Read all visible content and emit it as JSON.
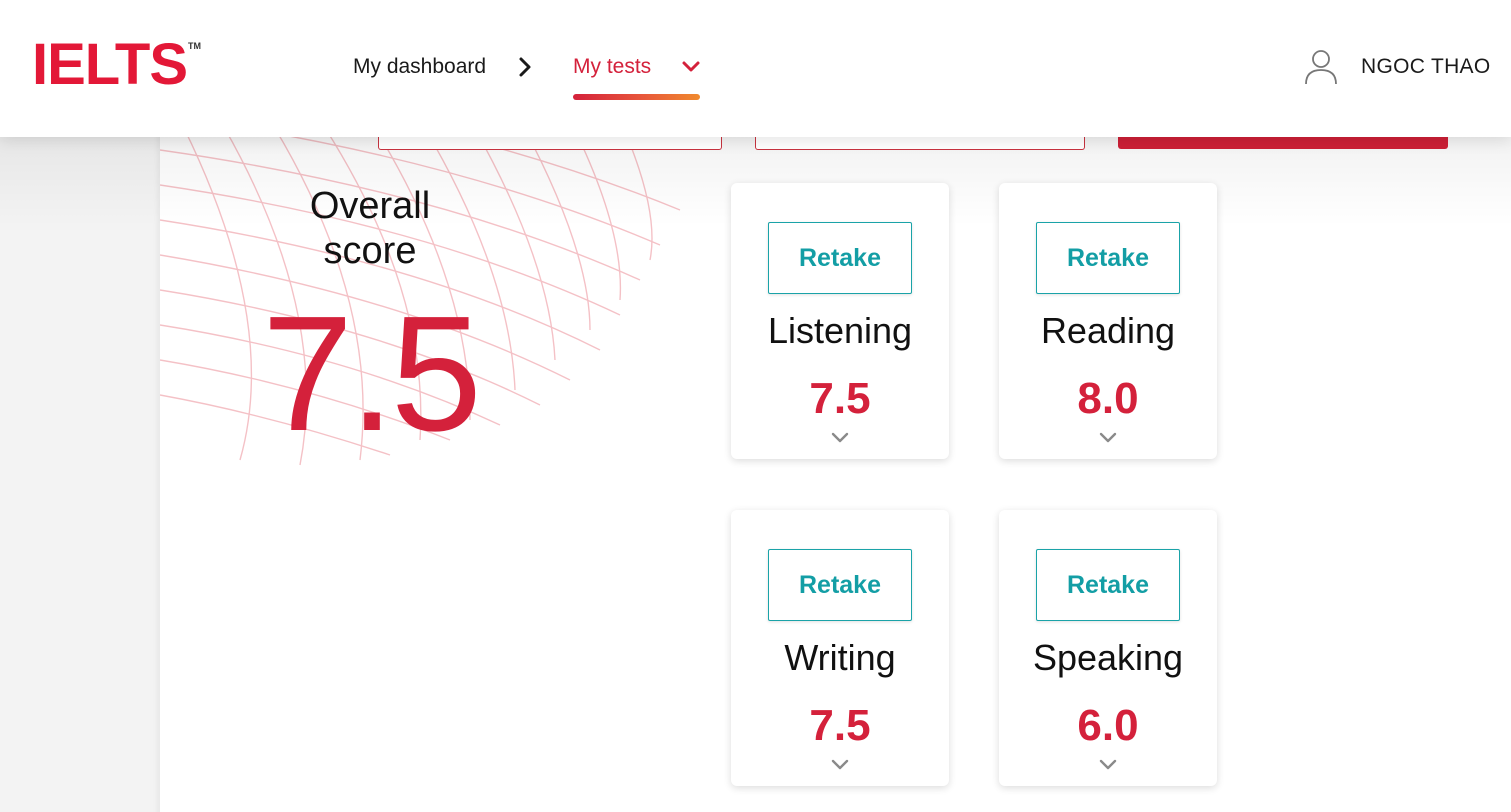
{
  "header": {
    "logo": "IELTS",
    "logo_tm": "TM",
    "nav": {
      "dashboard": "My dashboard",
      "tests": "My tests"
    },
    "user_name": "NGOC THAO"
  },
  "overall": {
    "label": "Overall\nscore",
    "score": "7.5"
  },
  "scores": [
    {
      "retake": "Retake",
      "title": "Listening",
      "score": "7.5"
    },
    {
      "retake": "Retake",
      "title": "Reading",
      "score": "8.0"
    },
    {
      "retake": "Retake",
      "title": "Writing",
      "score": "7.5"
    },
    {
      "retake": "Retake",
      "title": "Speaking",
      "score": "6.0"
    }
  ],
  "colors": {
    "brand_red": "#d4213b",
    "teal": "#139ea5",
    "nav_underline_end": "#f08a2d"
  },
  "icons": {
    "nav_separator": "chevron-right-icon",
    "nav_dropdown": "chevron-down-icon",
    "user": "user-icon",
    "expand": "chevron-down-icon"
  }
}
